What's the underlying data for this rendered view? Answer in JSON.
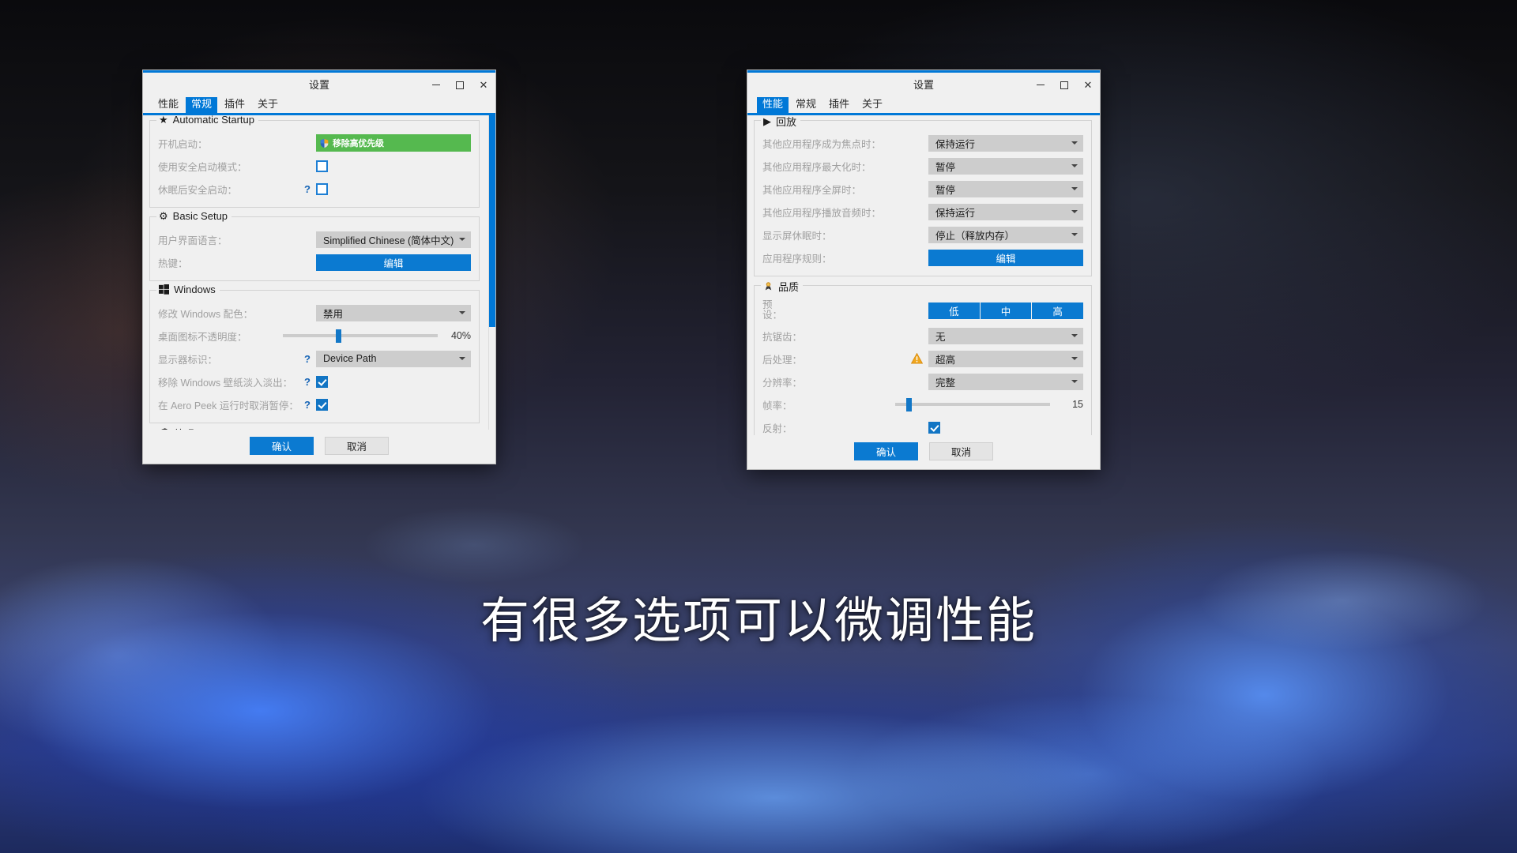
{
  "subtitle": "有很多选项可以微调性能",
  "left_window": {
    "title": "设置",
    "controls": {
      "minimize": "–",
      "maximize": "□",
      "close": "✕"
    },
    "tabs": [
      {
        "label": "性能",
        "active": false
      },
      {
        "label": "常规",
        "active": true
      },
      {
        "label": "插件",
        "active": false
      },
      {
        "label": "关于",
        "active": false
      }
    ],
    "groups": [
      {
        "icon": "star-icon",
        "icon_glyph": "★",
        "title": "Automatic Startup",
        "rows": [
          {
            "label": "开机启动：",
            "type": "green-button",
            "value": "移除高优先级",
            "help": false
          },
          {
            "label": "使用安全启动模式：",
            "type": "checkbox",
            "checked": false,
            "help": false
          },
          {
            "label": "休眠后安全启动：",
            "type": "checkbox",
            "checked": false,
            "help": true
          }
        ]
      },
      {
        "icon": "gear-icon",
        "icon_glyph": "⚙",
        "title": "Basic Setup",
        "rows": [
          {
            "label": "用户界面语言：",
            "type": "combo",
            "value": "Simplified Chinese (简体中文)",
            "help": false
          },
          {
            "label": "热键：",
            "type": "blue-button",
            "value": "编辑",
            "help": false
          }
        ]
      },
      {
        "icon": "windows-icon",
        "icon_glyph": "⊞",
        "title": "Windows",
        "rows": [
          {
            "label": "修改 Windows 配色：",
            "type": "combo",
            "value": "禁用",
            "help": false
          },
          {
            "label": "桌面图标不透明度：",
            "type": "slider",
            "value": "40%",
            "percent": 40,
            "help": false
          },
          {
            "label": "显示器标识：",
            "type": "combo",
            "value": "Device Path",
            "help": true
          },
          {
            "label": "移除 Windows 壁纸淡入淡出：",
            "type": "checkbox",
            "checked": true,
            "help": true
          },
          {
            "label": "在 Aero Peek 运行时取消暂停：",
            "type": "checkbox",
            "checked": true,
            "help": true
          }
        ]
      },
      {
        "icon": "palette-icon",
        "icon_glyph": "🎨",
        "title": "外观",
        "rows": []
      }
    ],
    "footer": {
      "ok": "确认",
      "cancel": "取消"
    }
  },
  "right_window": {
    "title": "设置",
    "controls": {
      "minimize": "–",
      "maximize": "□",
      "close": "✕"
    },
    "tabs": [
      {
        "label": "性能",
        "active": true
      },
      {
        "label": "常规",
        "active": false
      },
      {
        "label": "插件",
        "active": false
      },
      {
        "label": "关于",
        "active": false
      }
    ],
    "groups": [
      {
        "icon": "play-icon",
        "icon_glyph": "▶",
        "title": "回放",
        "rows": [
          {
            "label": "其他应用程序成为焦点时：",
            "type": "combo",
            "value": "保持运行",
            "help": false
          },
          {
            "label": "其他应用程序最大化时：",
            "type": "combo",
            "value": "暂停",
            "help": false
          },
          {
            "label": "其他应用程序全屏时：",
            "type": "combo",
            "value": "暂停",
            "help": false
          },
          {
            "label": "其他应用程序播放音频时：",
            "type": "combo",
            "value": "保持运行",
            "help": false
          },
          {
            "label": "显示屏休眠时：",
            "type": "combo",
            "value": "停止（释放内存）",
            "help": false
          },
          {
            "label": "应用程序规则：",
            "type": "blue-button",
            "value": "编辑",
            "help": false
          }
        ]
      },
      {
        "icon": "quality-icon",
        "icon_glyph": "🏆",
        "title": "品质",
        "rows": [
          {
            "label": "预\n设：",
            "type": "segmented",
            "options": [
              "低",
              "中",
              "高"
            ],
            "help": false
          },
          {
            "label": "抗锯齿：",
            "type": "combo",
            "value": "无",
            "help": false
          },
          {
            "label": "后处理：",
            "type": "combo",
            "value": "超高",
            "warn": true
          },
          {
            "label": "分辨率：",
            "type": "combo",
            "value": "完整",
            "help": false
          },
          {
            "label": "帧率：",
            "type": "slider",
            "value": "15",
            "percent": 8,
            "help": false
          },
          {
            "label": "反射：",
            "type": "checkbox",
            "checked": true,
            "help": false
          }
        ]
      }
    ],
    "footer": {
      "ok": "确认",
      "cancel": "取消"
    }
  }
}
